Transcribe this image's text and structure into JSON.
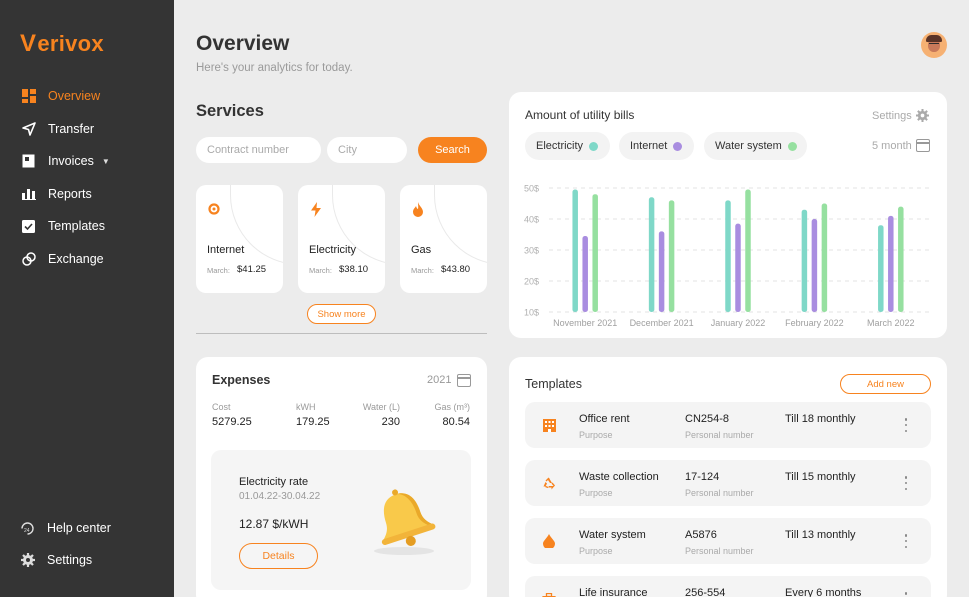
{
  "brand": {
    "logo_text": "erivox",
    "logo_initial": "V",
    "accent": "#f7831f"
  },
  "sidebar": {
    "items": [
      {
        "label": "Overview",
        "icon": "grid-icon",
        "active": true
      },
      {
        "label": "Transfer",
        "icon": "send-icon"
      },
      {
        "label": "Invoices",
        "icon": "invoice-icon",
        "has_dropdown": true
      },
      {
        "label": "Reports",
        "icon": "bar-chart-icon"
      },
      {
        "label": "Templates",
        "icon": "checkbox-icon"
      },
      {
        "label": "Exchange",
        "icon": "exchange-icon"
      }
    ],
    "bottom": [
      {
        "label": "Help center",
        "icon": "help-24-icon"
      },
      {
        "label": "Settings",
        "icon": "gear-icon"
      }
    ]
  },
  "header": {
    "title": "Overview",
    "subtitle": "Here's your analytics for today."
  },
  "services": {
    "title": "Services",
    "contract_placeholder": "Contract number",
    "city_placeholder": "City",
    "search_label": "Search",
    "cards": [
      {
        "name": "Internet",
        "month": "March:",
        "amount": "$41.25",
        "icon": "internet-icon"
      },
      {
        "name": "Electricity",
        "month": "March:",
        "amount": "$38.10",
        "icon": "lightning-icon"
      },
      {
        "name": "Gas",
        "month": "March:",
        "amount": "$43.80",
        "icon": "flame-icon"
      }
    ],
    "show_more": "Show more"
  },
  "expenses": {
    "title": "Expenses",
    "year": "2021",
    "stats": [
      {
        "label": "Cost",
        "value": "5279.25"
      },
      {
        "label": "kWH",
        "value": "179.25"
      },
      {
        "label": "Water (L)",
        "value": "230"
      },
      {
        "label": "Gas (m³)",
        "value": "80.54"
      }
    ],
    "rate": {
      "title": "Electricity rate",
      "dates": "01.04.22-30.04.22",
      "value": "12.87 $/kWH",
      "details_label": "Details"
    }
  },
  "bills": {
    "title": "Amount of utility bills",
    "settings_label": "Settings",
    "period_label": "5 month",
    "legend": [
      {
        "name": "Electricity",
        "color": "#7fd8c8"
      },
      {
        "name": "Internet",
        "color": "#a98de0"
      },
      {
        "name": "Water system",
        "color": "#96e0a0"
      }
    ]
  },
  "chart_data": {
    "type": "bar",
    "categories": [
      "November 2021",
      "December 2021",
      "January 2022",
      "February 2022",
      "March 2022"
    ],
    "series": [
      {
        "name": "Electricity",
        "values": [
          49.5,
          47,
          46,
          43,
          38
        ]
      },
      {
        "name": "Internet",
        "values": [
          34.5,
          36,
          38.5,
          40,
          41
        ]
      },
      {
        "name": "Water system",
        "values": [
          48,
          46,
          49.5,
          45,
          44
        ]
      }
    ],
    "y_ticks": [
      "10$",
      "20$",
      "30$",
      "40$",
      "50$"
    ],
    "ylim": [
      10,
      50
    ],
    "grid": true,
    "legend_position": "top-left"
  },
  "templates": {
    "title": "Templates",
    "add_label": "Add new",
    "rows": [
      {
        "name": "Office rent",
        "sub": "Purpose",
        "number": "CN254-8",
        "number_sub": "Personal number",
        "frequency": "Till 18 monthly",
        "icon": "building-icon"
      },
      {
        "name": "Waste collection",
        "sub": "Purpose",
        "number": "17-124",
        "number_sub": "Personal number",
        "frequency": "Till 15 monthly",
        "icon": "recycle-icon"
      },
      {
        "name": "Water system",
        "sub": "Purpose",
        "number": "A5876",
        "number_sub": "Personal number",
        "frequency": "Till 13 monthly",
        "icon": "water-drop-icon"
      },
      {
        "name": "Life insurance",
        "sub": "",
        "number": "256-554",
        "number_sub": "",
        "frequency": "Every 6 months",
        "icon": "briefcase-icon"
      }
    ]
  }
}
